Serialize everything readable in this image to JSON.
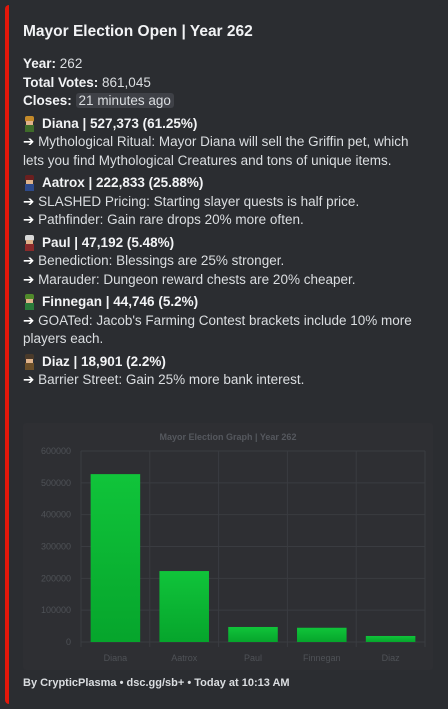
{
  "title": "Mayor Election Open | Year 262",
  "meta": {
    "year_label": "Year:",
    "year_value": "262",
    "votes_label": "Total Votes:",
    "votes_value": "861,045",
    "closes_label": "Closes:",
    "closes_value": "21 minutes ago"
  },
  "candidates": [
    {
      "header": "Diana | 527,373 (61.25%)",
      "icon": "diana-sprite-icon",
      "perks": [
        "Mythological Ritual: Mayor Diana will sell the Griffin pet, which lets you find Mythological Creatures and tons of unique items."
      ]
    },
    {
      "header": "Aatrox | 222,833 (25.88%)",
      "icon": "aatrox-sprite-icon",
      "perks": [
        "SLASHED Pricing: Starting slayer quests is half price.",
        "Pathfinder: Gain rare drops 20% more often."
      ]
    },
    {
      "header": "Paul | 47,192 (5.48%)",
      "icon": "paul-sprite-icon",
      "perks": [
        "Benediction: Blessings are 25% stronger.",
        "Marauder: Dungeon reward chests are 20% cheaper."
      ]
    },
    {
      "header": "Finnegan | 44,746 (5.2%)",
      "icon": "finnegan-sprite-icon",
      "perks": [
        "GOATed: Jacob's Farming Contest brackets include 10% more players each."
      ]
    },
    {
      "header": "Diaz | 18,901 (2.2%)",
      "icon": "diaz-sprite-icon",
      "perks": [
        "Barrier Street: Gain 25% more bank interest."
      ]
    }
  ],
  "chart_data": {
    "type": "bar",
    "title": "Mayor Election Graph | Year 262",
    "categories": [
      "Diana",
      "Aatrox",
      "Paul",
      "Finnegan",
      "Diaz"
    ],
    "values": [
      527373,
      222833,
      47192,
      44746,
      18901
    ],
    "ylim": [
      0,
      600000
    ],
    "yticks": [
      0,
      100000,
      200000,
      300000,
      400000,
      500000,
      600000
    ],
    "grid": true
  },
  "footer": "By CrypticPlasma • dsc.gg/sb+ • Today at 10:13 AM",
  "colors": {
    "accent": "#e3170a",
    "bar_top": "#10c43a",
    "bar_bottom": "#06a52c"
  }
}
